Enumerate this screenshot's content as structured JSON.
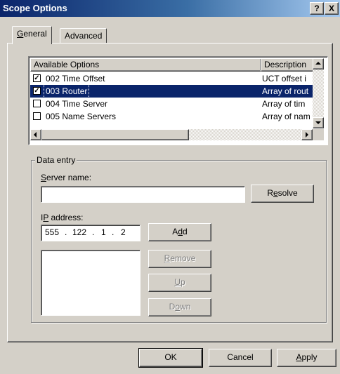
{
  "window": {
    "title": "Scope Options",
    "help_glyph": "?",
    "close_glyph": "X"
  },
  "tabs": [
    {
      "label_u": "G",
      "label_rest": "eneral"
    },
    {
      "label_u": "",
      "label_rest": "Advanced"
    }
  ],
  "list": {
    "headers": {
      "options": "Available Options",
      "description": "Description"
    },
    "rows": [
      {
        "name": "002 Time Offset",
        "description": "UCT offset i",
        "checked": true,
        "selected": false
      },
      {
        "name": "003 Router",
        "description": "Array of rout",
        "checked": true,
        "selected": true
      },
      {
        "name": "004 Time Server",
        "description": "Array of tim",
        "checked": false,
        "selected": false
      },
      {
        "name": "005 Name Servers",
        "description": "Array of nam",
        "checked": false,
        "selected": false
      }
    ]
  },
  "data_entry": {
    "legend": "Data entry",
    "server_name_label_u": "S",
    "server_name_label_rest": "erver name:",
    "server_name_value": "",
    "resolve_u": "e",
    "resolve_pre": "R",
    "resolve_post": "solve",
    "ip_label_pre": "I",
    "ip_label_u": "P",
    "ip_label_post": " address:",
    "ip_parts": [
      "555",
      "122",
      "1",
      "2"
    ],
    "add_pre": "A",
    "add_u": "d",
    "add_post": "d",
    "remove_u": "R",
    "remove_post": "emove",
    "up_u": "U",
    "up_post": "p",
    "down_pre": "D",
    "down_u": "o",
    "down_post": "wn"
  },
  "footer": {
    "ok": "OK",
    "cancel": "Cancel",
    "apply_u": "A",
    "apply_post": "pply"
  }
}
